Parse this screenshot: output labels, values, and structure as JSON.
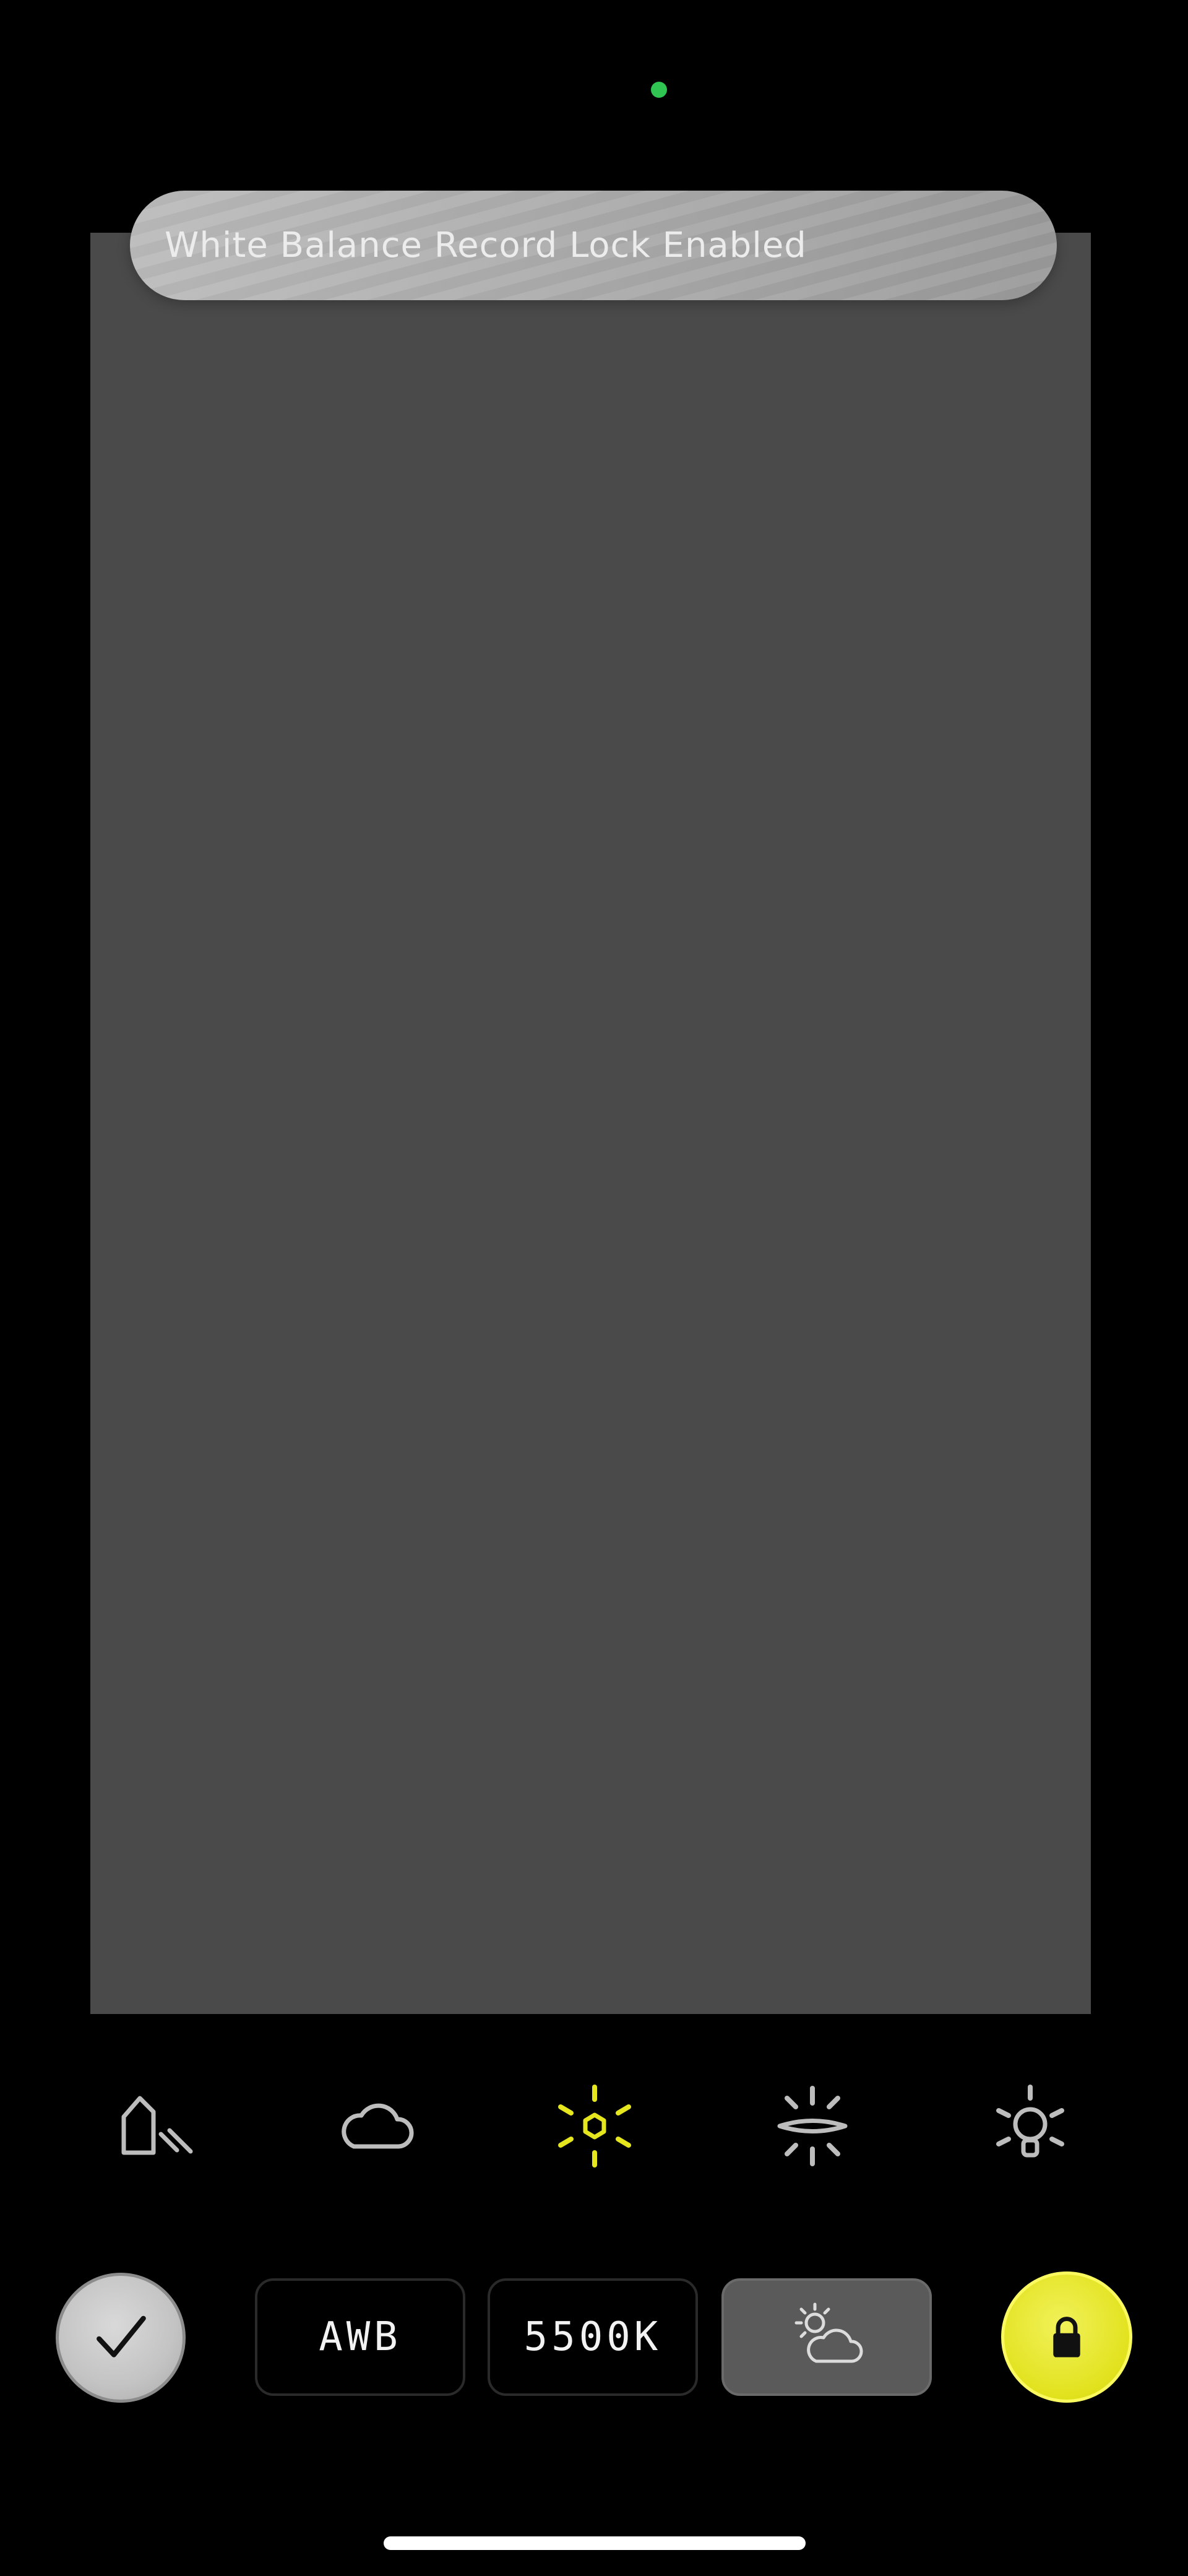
{
  "toast": {
    "message": "White Balance Record Lock Enabled"
  },
  "wb_presets": [
    {
      "name": "shade-icon",
      "selected": false
    },
    {
      "name": "cloudy-icon",
      "selected": false
    },
    {
      "name": "daylight-icon",
      "selected": true
    },
    {
      "name": "fluorescent-icon",
      "selected": false
    },
    {
      "name": "incandescent-icon",
      "selected": false
    }
  ],
  "controls": {
    "awb_label": "AWB",
    "kelvin_label": "5500K",
    "weather_icon": "partly-cloudy-icon",
    "confirm_icon": "checkmark-icon",
    "lock_icon": "lock-icon"
  },
  "colors": {
    "accent": "#E6E61F",
    "viewfinder": "#4A4A4A",
    "privacy_indicator": "#30C453"
  }
}
